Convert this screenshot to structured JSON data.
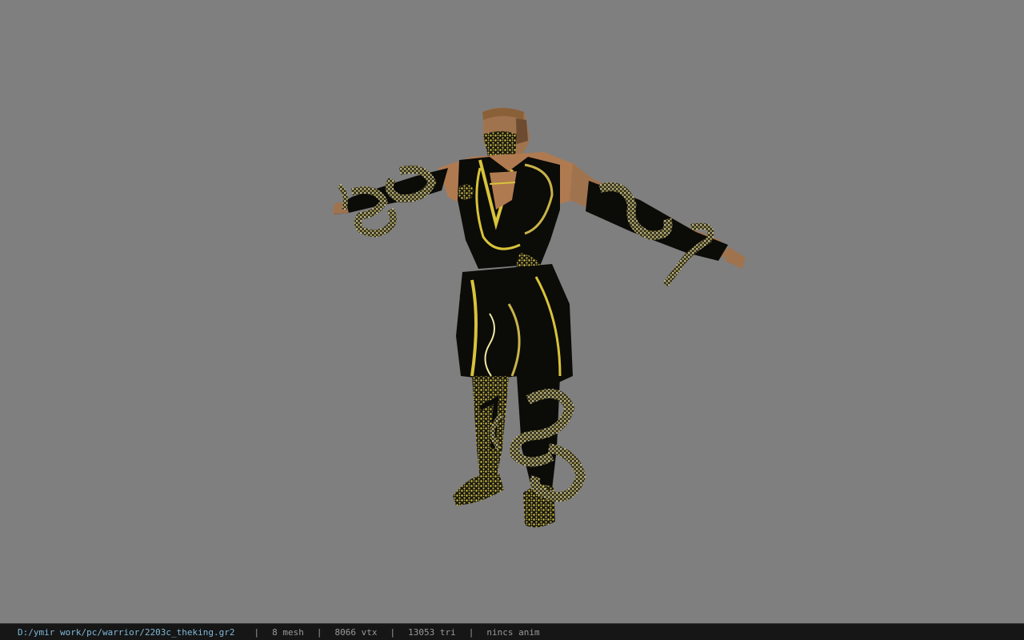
{
  "viewport": {
    "background_color": "#7f7f7f",
    "model_subject": "warrior-character-tpose"
  },
  "status_bar": {
    "file_path": "D:/ymir work/pc/warrior/2203c_theking.gr2",
    "separator": "|",
    "mesh_count": "8 mesh",
    "vertex_count": "8066 vtx",
    "triangle_count": "13053 tri",
    "anim_status": "nincs anim",
    "path_color": "#7fb8d8"
  }
}
